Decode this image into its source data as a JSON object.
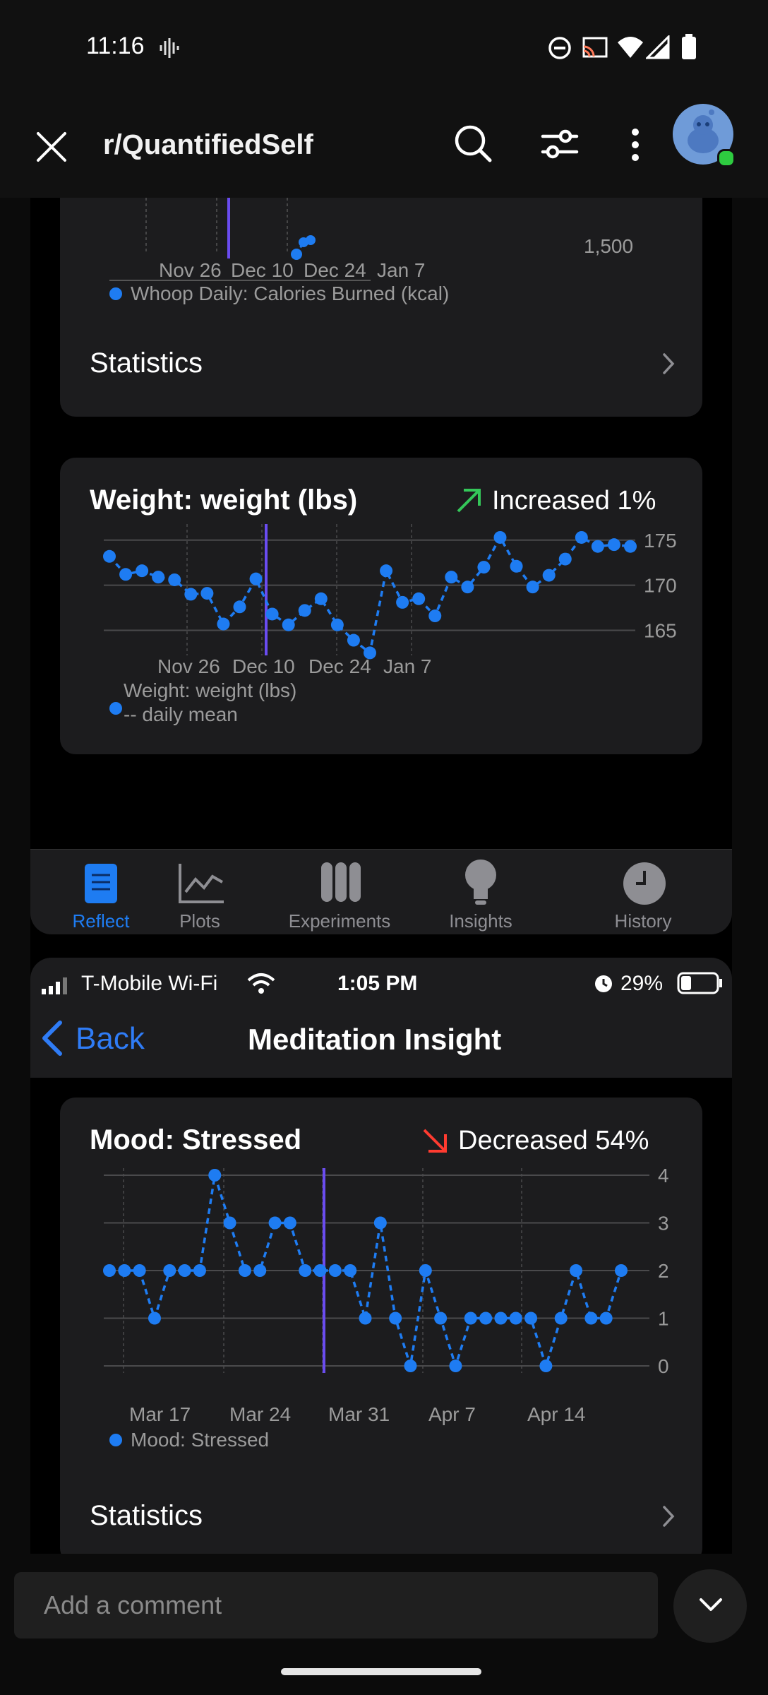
{
  "status_bar": {
    "time": "11:16"
  },
  "header": {
    "subreddit": "r/QuantifiedSelf"
  },
  "calories_card": {
    "tick_y": "1,500",
    "x_ticks": [
      "Nov 26",
      "Dec 10",
      "Dec 24",
      "Jan 7"
    ],
    "legend": "Whoop Daily: Calories Burned (kcal)",
    "statistics_label": "Statistics"
  },
  "weight_card": {
    "title": "Weight: weight (lbs)",
    "trend_text": "Increased 1%",
    "trend_color": "#34c759",
    "y_ticks": [
      "175",
      "170",
      "165"
    ],
    "x_ticks": [
      "Nov 26",
      "Dec 10",
      "Dec 24",
      "Jan 7"
    ],
    "legend_line1": "Weight: weight (lbs)",
    "legend_line2": "-- daily mean"
  },
  "tab_bar": {
    "tabs": [
      {
        "label": "Reflect",
        "icon": "document-icon",
        "active": true
      },
      {
        "label": "Plots",
        "icon": "line-chart-icon",
        "active": false
      },
      {
        "label": "Experiments",
        "icon": "test-tubes-icon",
        "active": false
      },
      {
        "label": "Insights",
        "icon": "lightbulb-icon",
        "active": false
      },
      {
        "label": "History",
        "icon": "clock-icon",
        "active": false
      }
    ]
  },
  "ios_status": {
    "carrier": "T-Mobile Wi-Fi",
    "time": "1:05 PM",
    "battery": "29%"
  },
  "ios_nav": {
    "back_label": "Back",
    "title": "Meditation Insight"
  },
  "mood_card": {
    "title": "Mood: Stressed",
    "trend_text": "Decreased 54%",
    "trend_color": "#ff3b30",
    "y_ticks": [
      "4",
      "3",
      "2",
      "1",
      "0"
    ],
    "x_ticks": [
      "Mar 17",
      "Mar 24",
      "Mar 31",
      "Apr 7",
      "Apr 14"
    ],
    "legend": "Mood: Stressed",
    "statistics_label": "Statistics"
  },
  "comment": {
    "placeholder": "Add a comment"
  },
  "colors": {
    "accent_blue": "#1e7cf2",
    "marker_purple": "#6a4cf0",
    "background": "#000000"
  },
  "chart_data": [
    {
      "type": "line",
      "title": "Weight: weight (lbs)",
      "series": [
        {
          "name": "Weight: weight (lbs) -- daily mean",
          "values": [
            173.2,
            171.2,
            171.6,
            170.9,
            170.6,
            169.0,
            169.1,
            165.7,
            167.6,
            170.7,
            166.8,
            165.6,
            167.2,
            168.5,
            165.6,
            163.9,
            162.5,
            171.6,
            168.1,
            168.5,
            166.6,
            170.9,
            169.8,
            172.0,
            175.3,
            172.1,
            169.8,
            171.1,
            172.9,
            175.3,
            174.3,
            174.5,
            174.3
          ]
        }
      ],
      "x_ticks": [
        "Nov 26",
        "Dec 10",
        "Dec 24",
        "Jan 7"
      ],
      "ylim": [
        163,
        176
      ]
    },
    {
      "type": "line",
      "title": "Mood: Stressed",
      "series": [
        {
          "name": "Mood: Stressed",
          "values": [
            2,
            2,
            2,
            1,
            2,
            2,
            2,
            4,
            3,
            2,
            2,
            3,
            3,
            2,
            2,
            2,
            2,
            1,
            3,
            1,
            0,
            2,
            1,
            0,
            1,
            1,
            1,
            1,
            1,
            0,
            1,
            2,
            1,
            1,
            2
          ]
        }
      ],
      "x_ticks": [
        "Mar 17",
        "Mar 24",
        "Mar 31",
        "Apr 7",
        "Apr 14"
      ],
      "ylim": [
        0,
        4
      ]
    }
  ]
}
